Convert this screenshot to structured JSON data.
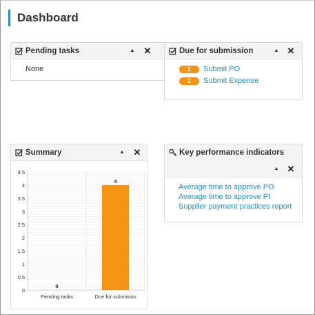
{
  "page": {
    "title": "Dashboard"
  },
  "pending": {
    "title": "Pending tasks",
    "collapse_glyph": "▲",
    "close_glyph": "✕",
    "empty_text": "None"
  },
  "due": {
    "title": "Due for submission",
    "collapse_glyph": "▲",
    "close_glyph": "✕",
    "items": [
      {
        "count": "2",
        "label": "Submit PO"
      },
      {
        "count": "2",
        "label": "Submit Expense"
      }
    ]
  },
  "summary": {
    "title": "Summary",
    "collapse_glyph": "▲",
    "close_glyph": "✕"
  },
  "kpi": {
    "title": "Key performance indicators",
    "collapse_glyph": "▲",
    "close_glyph": "✕",
    "links": [
      "Average time to approve PO",
      "Average time to approve PI",
      "Supplier payment practices report"
    ]
  },
  "colors": {
    "accent": "#2a8fd0",
    "badge": "#f39417",
    "bar": "#f39417"
  },
  "chart_data": {
    "type": "bar",
    "title": "",
    "xlabel": "",
    "ylabel": "",
    "categories": [
      "Pending tasks",
      "Due for submissio"
    ],
    "values": [
      0,
      4
    ],
    "data_labels": [
      "0",
      "4"
    ],
    "ylim": [
      0,
      4.5
    ],
    "yticks": [
      "0",
      "0.5",
      "1",
      "1.5",
      "2",
      "2.5",
      "3",
      "3.5",
      "4",
      "4.5"
    ],
    "grid": true
  }
}
